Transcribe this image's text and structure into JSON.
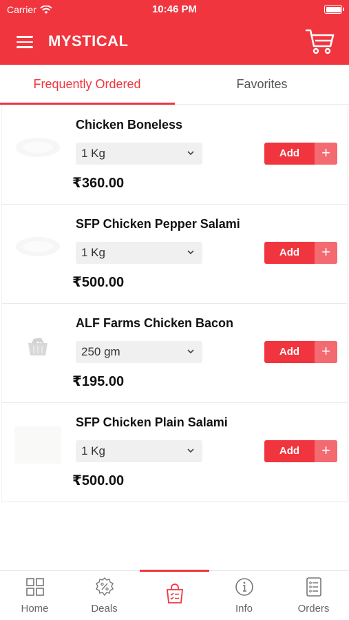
{
  "status_bar": {
    "carrier": "Carrier",
    "time": "10:46 PM"
  },
  "header": {
    "title": "MYSTICAL",
    "menu_icon": "hamburger-menu-icon",
    "cart_icon": "shopping-cart-icon"
  },
  "colors": {
    "accent": "#f0353e",
    "accent_light": "#f46a71"
  },
  "tabs": [
    {
      "label": "Frequently Ordered",
      "active": true
    },
    {
      "label": "Favorites",
      "active": false
    }
  ],
  "products": [
    {
      "name": "Chicken Boneless",
      "weight": "1 Kg",
      "price": "₹360.00",
      "add_label": "Add",
      "plus": "+"
    },
    {
      "name": "SFP Chicken Pepper Salami",
      "weight": "1 Kg",
      "price": "₹500.00",
      "add_label": "Add",
      "plus": "+"
    },
    {
      "name": "ALF Farms Chicken Bacon",
      "weight": "250 gm",
      "price": "₹195.00",
      "add_label": "Add",
      "plus": "+"
    },
    {
      "name": "SFP Chicken Plain Salami",
      "weight": "1 Kg",
      "price": "₹500.00",
      "add_label": "Add",
      "plus": "+"
    }
  ],
  "bottom_nav": [
    {
      "label": "Home",
      "icon": "grid-icon",
      "active": false
    },
    {
      "label": "Deals",
      "icon": "discount-badge-icon",
      "active": false
    },
    {
      "label": "",
      "icon": "shopping-bag-checklist-icon",
      "active": true
    },
    {
      "label": "Info",
      "icon": "info-icon",
      "active": false
    },
    {
      "label": "Orders",
      "icon": "orders-list-icon",
      "active": false
    }
  ]
}
